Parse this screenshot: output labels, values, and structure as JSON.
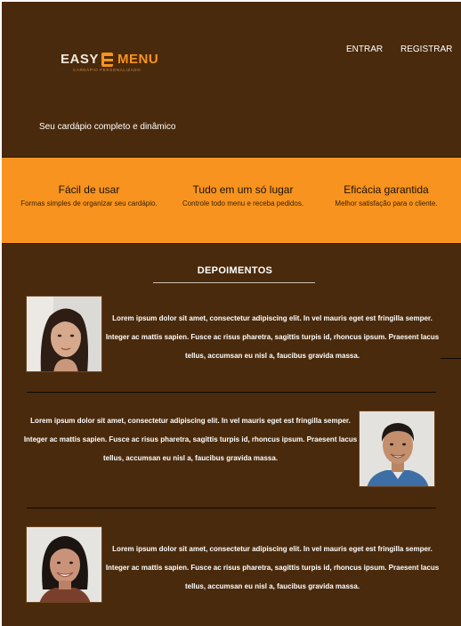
{
  "brand": {
    "name_part1": "EASY",
    "name_part2": "MENU",
    "tagline": "CARDÁPIO PERSONALIZADO",
    "colors": {
      "accent": "#f7931e",
      "background": "#4a2a0c"
    }
  },
  "nav": {
    "login": "ENTRAR",
    "register": "REGISTRAR"
  },
  "hero": {
    "subtitle": "Seu cardápio completo e dinâmico"
  },
  "features": [
    {
      "title": "Fácil de usar",
      "description": "Formas simples de organizar seu cardápio."
    },
    {
      "title": "Tudo em um só lugar",
      "description": "Controle todo menu e receba pedidos."
    },
    {
      "title": "Eficácia garantida",
      "description": "Melhor satisfação para o cliente."
    }
  ],
  "testimonials": {
    "heading": "DEPOIMENTOS",
    "items": [
      {
        "avatar_icon": "woman-long-hair-portrait",
        "lines": [
          "Lorem ipsum dolor sit amet, consectetur adipiscing elit. In vel mauris eget est fringilla semper.",
          "Integer ac mattis sapien. Fusce ac risus pharetra, sagittis turpis id, rhoncus ipsum. Praesent lacus",
          "tellus, accumsan eu nisl a, faucibus gravida massa."
        ]
      },
      {
        "avatar_icon": "man-smiling-portrait",
        "lines": [
          "Lorem ipsum dolor sit amet, consectetur adipiscing elit. In vel mauris eget est fringilla semper.",
          "Integer ac mattis sapien. Fusce ac risus pharetra, sagittis turpis id, rhoncus ipsum. Praesent lacus",
          "tellus, accumsan eu nisl a, faucibus gravida massa."
        ]
      },
      {
        "avatar_icon": "woman-smiling-portrait",
        "lines": [
          "Lorem ipsum dolor sit amet, consectetur adipiscing elit. In vel mauris eget est fringilla semper.",
          "Integer ac mattis sapien. Fusce ac risus pharetra, sagittis turpis id, rhoncus ipsum. Praesent lacus",
          "tellus, accumsan eu nisl a, faucibus gravida massa."
        ]
      }
    ]
  }
}
